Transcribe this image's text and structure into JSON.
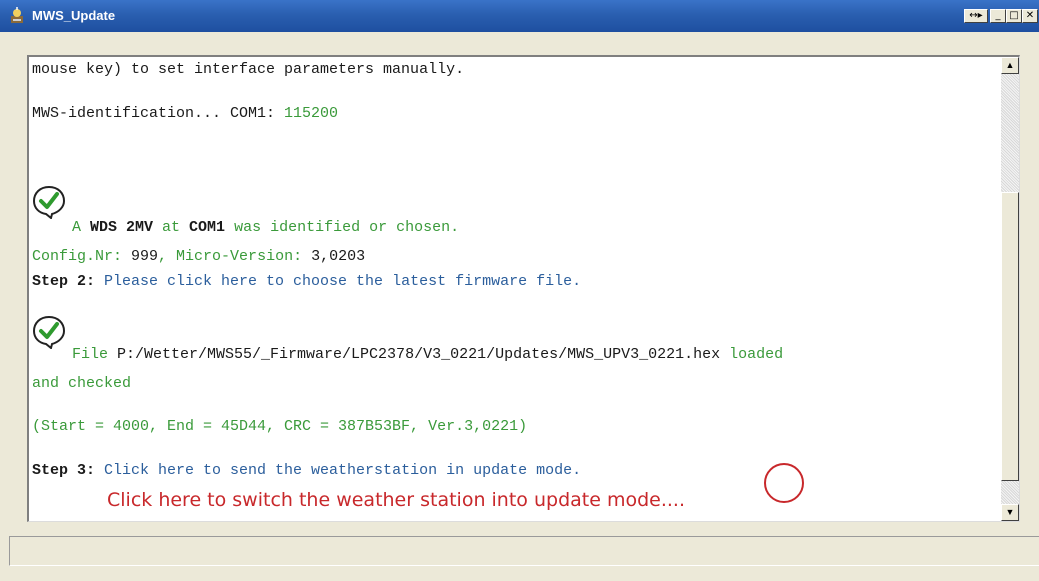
{
  "window": {
    "title": "MWS_Update",
    "buttons": {
      "extra": "↔▸",
      "minimize": "_",
      "maximize": "□",
      "close": "✕"
    }
  },
  "log": {
    "line1": "mouse key) to set interface parameters manually.",
    "line2_prefix": "MWS-identification... COM1: ",
    "line2_value": "115200",
    "ident": {
      "a": "A ",
      "device": "WDS 2MV",
      "at": " at ",
      "port": "COM1",
      "rest": " was identified or chosen."
    },
    "config": {
      "label1": "Config.Nr: ",
      "value1": "999",
      "sep": ", Micro-Version: ",
      "value2": "3,0203"
    },
    "step2": {
      "label": "Step 2: ",
      "text": "Please click here to choose the latest firmware file."
    },
    "file": {
      "label": "File ",
      "path": "P:/Wetter/MWS55/_Firmware/LPC2378/V3_0221/Updates/MWS_UPV3_0221.hex",
      "suffix": " loaded",
      "line2": "and checked"
    },
    "checksum": "(Start = 4000, End = 45D44, CRC = 387B53BF, Ver.3,0221)",
    "step3": {
      "label": "Step 3: ",
      "text": "Click here to send the weatherstation in update mode."
    }
  },
  "annotation": "Click here to switch the weather station into update mode....",
  "icons": [
    "check-icon",
    "app-icon",
    "scroll-up-icon",
    "scroll-down-icon"
  ],
  "colors": {
    "green": "#3a9a3a",
    "blue": "#2b5e9c",
    "annotation_red": "#c8282b",
    "titlebar": "#2a5fb0"
  }
}
